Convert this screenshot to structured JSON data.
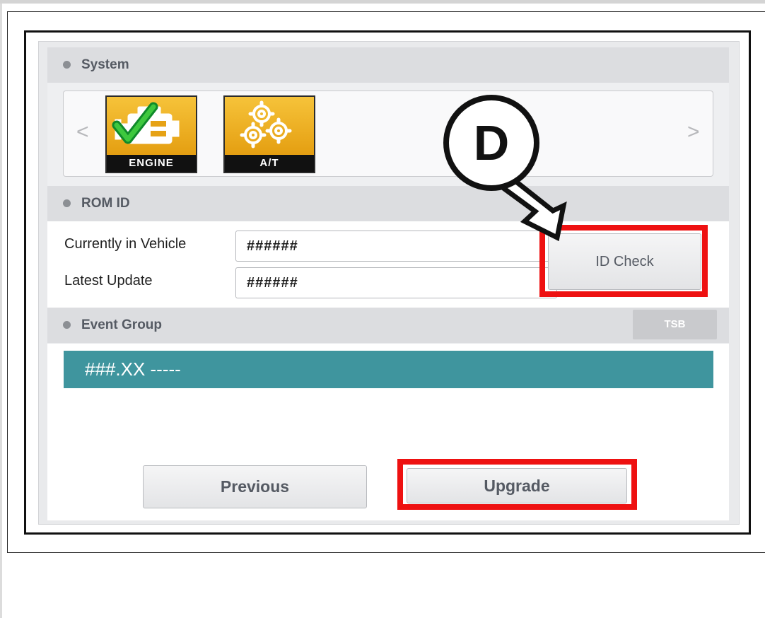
{
  "system": {
    "title": "System"
  },
  "modules": [
    {
      "label": "ENGINE",
      "icon": "engine-check-icon"
    },
    {
      "label": "A/T",
      "icon": "gears-icon"
    }
  ],
  "carousel": {
    "prev_label": "<",
    "next_label": ">"
  },
  "rom": {
    "title": "ROM ID",
    "current_label": "Currently in Vehicle",
    "current_value": "######",
    "latest_label": "Latest Update",
    "latest_value": "######",
    "id_check_label": "ID Check"
  },
  "event_group": {
    "title": "Event Group",
    "tsb_label": "TSB",
    "rows": [
      "###.XX -----"
    ]
  },
  "footer": {
    "previous_label": "Previous",
    "upgrade_label": "Upgrade"
  },
  "callout": {
    "letter": "D"
  },
  "colors": {
    "highlight": "#ee1111",
    "event_row": "#3f959e",
    "tile_gold": "#e6a215"
  }
}
